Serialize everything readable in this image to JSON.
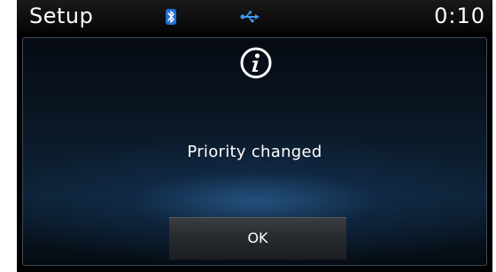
{
  "status_bar": {
    "title": "Setup",
    "time": "0:10",
    "icons": [
      "bluetooth-icon",
      "usb-icon"
    ]
  },
  "dialog": {
    "icon": "info-icon",
    "message": "Priority changed",
    "ok_label": "OK"
  },
  "colors": {
    "background": "#000000",
    "accent_blue": "#2f7fd8",
    "text": "#ffffff"
  }
}
